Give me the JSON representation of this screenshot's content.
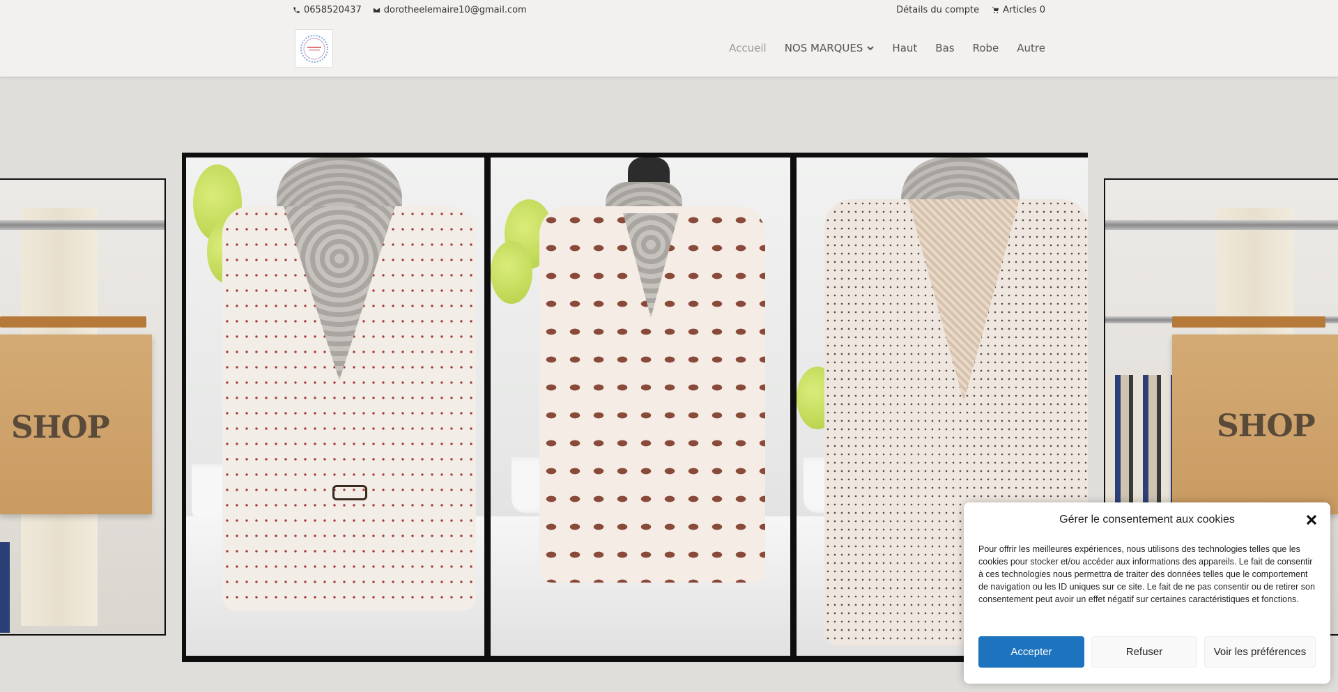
{
  "topbar": {
    "phone": "0658520437",
    "email": "dorotheelemaire10@gmail.com",
    "account": "Détails du compte",
    "cart": "Articles 0"
  },
  "nav": {
    "items": [
      {
        "label": "Accueil",
        "active": true
      },
      {
        "label": "NOS MARQUES",
        "dropdown": true
      },
      {
        "label": "Haut"
      },
      {
        "label": "Bas"
      },
      {
        "label": "Robe"
      },
      {
        "label": "Autre"
      }
    ]
  },
  "carousel": {
    "side_word": "SHOP"
  },
  "cookie": {
    "title": "Gérer le consentement aux cookies",
    "body": "Pour offrir les meilleures expériences, nous utilisons des technologies telles que les cookies pour stocker et/ou accéder aux informations des appareils. Le fait de consentir à ces technologies nous permettra de traiter des données telles que le comportement de navigation ou les ID uniques sur ce site. Le fait de ne pas consentir ou de retirer son consentement peut avoir un effet négatif sur certaines caractéristiques et fonctions.",
    "accept": "Accepter",
    "refuse": "Refuser",
    "prefs": "Voir les préférences"
  },
  "colors": {
    "accent": "#1e73be",
    "page_bg": "#e0dedb",
    "header_bg": "#f2f1ef"
  }
}
